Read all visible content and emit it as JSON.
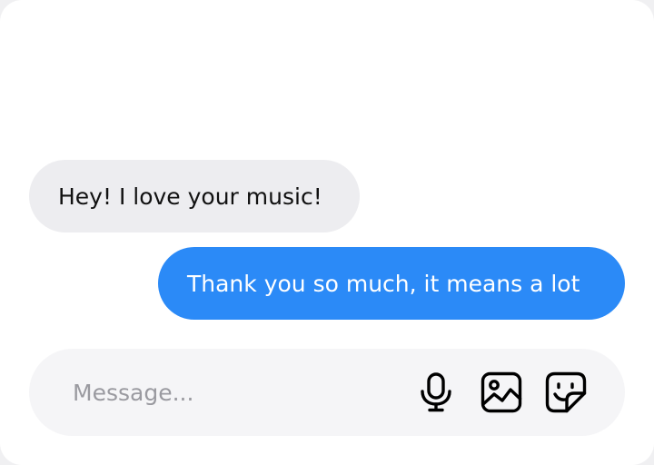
{
  "messages": [
    {
      "direction": "incoming",
      "text": "Hey! I love your music!"
    },
    {
      "direction": "outgoing",
      "text": "Thank you so much, it means a lot"
    }
  ],
  "composer": {
    "placeholder": "Message...",
    "value": "",
    "actions": [
      {
        "name": "microphone-icon",
        "label": ""
      },
      {
        "name": "image-icon",
        "label": ""
      },
      {
        "name": "sticker-icon",
        "label": ""
      }
    ]
  },
  "colors": {
    "outgoing_bubble": "#2b8af7",
    "incoming_bubble": "#ededf0",
    "composer_background": "#f5f5f7",
    "placeholder_text": "#9a9aa0"
  }
}
